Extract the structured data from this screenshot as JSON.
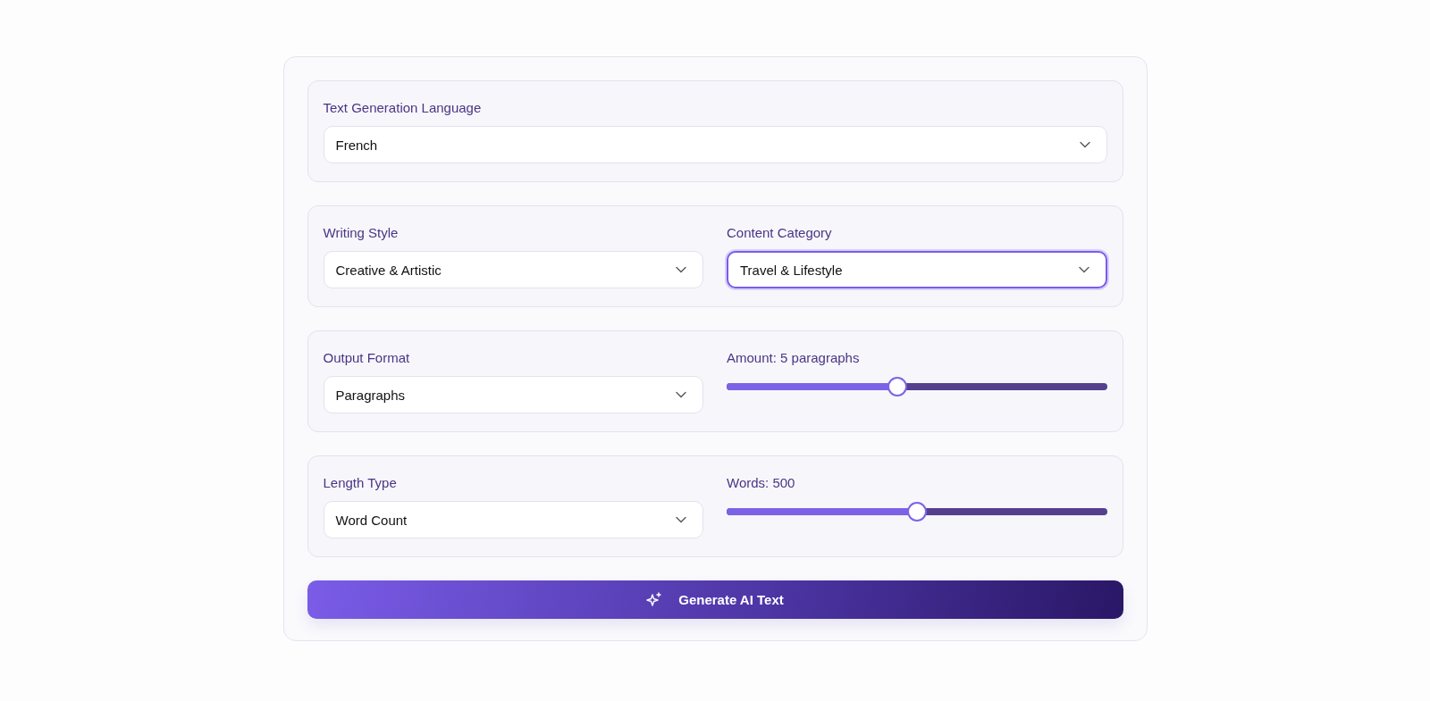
{
  "sections": [
    {
      "fields": [
        {
          "kind": "select",
          "label": "Text Generation Language",
          "value": "French",
          "focused": false
        }
      ]
    },
    {
      "fields": [
        {
          "kind": "select",
          "label": "Writing Style",
          "value": "Creative & Artistic",
          "focused": false
        },
        {
          "kind": "select",
          "label": "Content Category",
          "value": "Travel & Lifestyle",
          "focused": true
        }
      ]
    },
    {
      "fields": [
        {
          "kind": "select",
          "label": "Output Format",
          "value": "Paragraphs",
          "focused": false
        },
        {
          "kind": "slider",
          "label": "Amount: 5 paragraphs",
          "level": 0.45
        }
      ]
    },
    {
      "fields": [
        {
          "kind": "select",
          "label": "Length Type",
          "value": "Word Count",
          "focused": false
        },
        {
          "kind": "slider",
          "label": "Words: 500",
          "level": 0.5
        }
      ]
    }
  ],
  "generate_button": {
    "label": "Generate AI Text"
  }
}
